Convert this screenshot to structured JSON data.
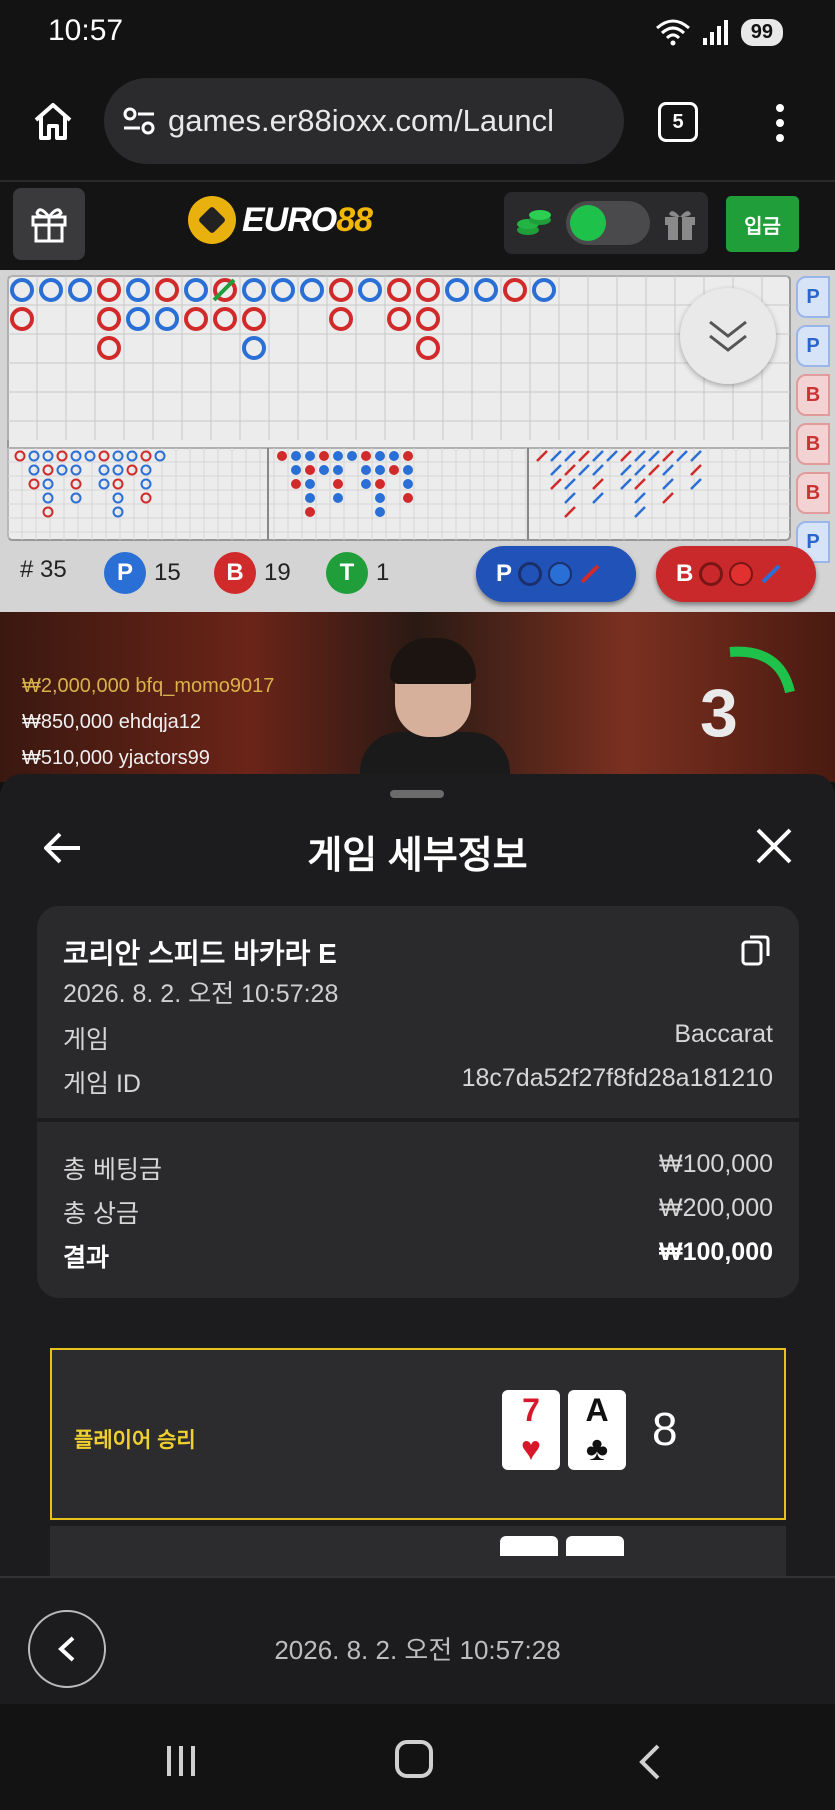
{
  "status_bar": {
    "time": "10:57",
    "battery": "99"
  },
  "browser": {
    "url": "games.er88ioxx.com/Launcl",
    "tab_count": "5"
  },
  "casino_header": {
    "logo_text": "EURO",
    "logo_accent": "88",
    "deposit_label": "입금"
  },
  "roadmap": {
    "side_pills": [
      "P",
      "P",
      "B",
      "B",
      "B",
      "P"
    ],
    "stats": {
      "count_label": "# 35",
      "player_letter": "P",
      "player_count": "15",
      "banker_letter": "B",
      "banker_count": "19",
      "tie_letter": "T",
      "tie_count": "1"
    },
    "predict_player": "P",
    "predict_banker": "B"
  },
  "video": {
    "winners": [
      {
        "amount": "₩2,000,000",
        "user": "bfq_momo9017"
      },
      {
        "amount": "₩850,000",
        "user": "ehdqja12"
      },
      {
        "amount": "₩510,000",
        "user": "yjactors99"
      }
    ],
    "countdown": "3"
  },
  "sheet": {
    "title": "게임 세부정보",
    "game_name": "코리안 스피드 바카라 E",
    "game_datetime": "2026. 8. 2. 오전 10:57:28",
    "game_label": "게임",
    "game_value": "Baccarat",
    "game_id_label": "게임 ID",
    "game_id_value": "18c7da52f27f8fd28a181210",
    "total_bet_label": "총 베팅금",
    "total_bet_value": "₩100,000",
    "total_win_label": "총 상금",
    "total_win_value": "₩200,000",
    "result_label": "결과",
    "result_value": "₩100,000",
    "outcome": {
      "label": "플레이어 승리",
      "cards": [
        {
          "rank": "7",
          "suit": "♥"
        },
        {
          "rank": "A",
          "suit": "♣"
        }
      ],
      "score": "8"
    }
  },
  "bottom": {
    "datetime": "2026. 8. 2. 오전 10:57:28"
  },
  "colors": {
    "player": "#2a6fd6",
    "banker": "#d12a2a",
    "tie": "#1f9e3a",
    "accent": "#e6c21b"
  }
}
